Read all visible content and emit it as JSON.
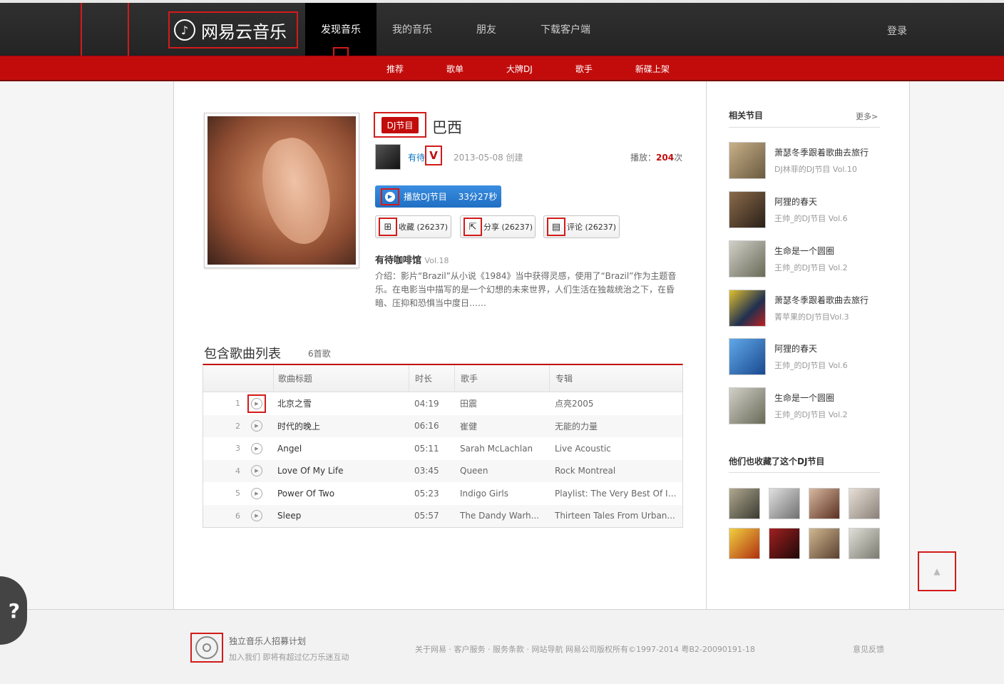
{
  "header": {
    "logo_text": "网易云音乐",
    "nav": [
      "发现音乐",
      "我的音乐",
      "朋友",
      "下载客户端"
    ],
    "login": "登录",
    "subnav": [
      "推荐",
      "歌单",
      "大牌DJ",
      "歌手",
      "新碟上架"
    ]
  },
  "program": {
    "tag": "DJ节目",
    "title": "巴西",
    "author": "有待",
    "verified_badge": "V",
    "created": "2013-05-08 创建",
    "plays_label": "播放：",
    "plays_count": "204",
    "plays_unit": "次",
    "play_button": "播放DJ节目",
    "duration": "33分27秒",
    "actions": {
      "collect": "收藏 (26237)",
      "share": "分享 (26237)",
      "comment": "评论 (26237)"
    },
    "radio_name": "有待咖啡馆",
    "radio_vol": "Vol.18",
    "description": "介绍：影片“Brazil”从小说《1984》当中获得灵感，使用了“Brazil”作为主题音乐。在电影当中描写的是一个幻想的未来世界，人们生活在独裁统治之下，在昏暗、压抑和恐惧当中度日……"
  },
  "songlist": {
    "title": "包含歌曲列表",
    "count": "6首歌",
    "headers": {
      "title": "歌曲标题",
      "duration": "时长",
      "artist": "歌手",
      "album": "专辑"
    },
    "rows": [
      {
        "idx": "1",
        "title": "北京之雪",
        "duration": "04:19",
        "artist": "田震",
        "album": "点亮2005"
      },
      {
        "idx": "2",
        "title": "时代的晚上",
        "duration": "06:16",
        "artist": "崔健",
        "album": "无能的力量"
      },
      {
        "idx": "3",
        "title": "Angel",
        "duration": "05:11",
        "artist": "Sarah McLachlan",
        "album": "Live Acoustic"
      },
      {
        "idx": "4",
        "title": "Love Of My Life",
        "duration": "03:45",
        "artist": "Queen",
        "album": "Rock Montreal"
      },
      {
        "idx": "5",
        "title": "Power Of Two",
        "duration": "05:23",
        "artist": "Indigo Girls",
        "album": "Playlist: The Very Best Of In..."
      },
      {
        "idx": "6",
        "title": "Sleep",
        "duration": "05:57",
        "artist": "The Dandy Warh...",
        "album": "Thirteen Tales From Urban..."
      }
    ]
  },
  "sidebar": {
    "related_title": "相关节目",
    "more": "更多>",
    "related": [
      {
        "name": "萧瑟冬季跟着歌曲去旅行",
        "sub": "DJ林菲的DJ节目 Vol.10",
        "color": "#8a7a5a"
      },
      {
        "name": "阿狸的春天",
        "sub": "王帅_的DJ节目 Vol.6",
        "color": "#5a4a3a"
      },
      {
        "name": "生命是一个圆圈",
        "sub": "王帅_的DJ节目 Vol.2",
        "color": "#7a7a6a"
      },
      {
        "name": "萧瑟冬季跟着歌曲去旅行",
        "sub": "菁苹果的DJ节目Vol.3",
        "color": "#c4a020"
      },
      {
        "name": "阿狸的春天",
        "sub": "王帅_的DJ节目 Vol.6",
        "color": "#2a6ab0"
      },
      {
        "name": "生命是一个圆圈",
        "sub": "王帅_的DJ节目 Vol.2",
        "color": "#8a8a7a"
      }
    ],
    "collectors_title": "他们也收藏了这个DJ节目",
    "collectors": [
      "#6a6a5a",
      "#9a9a9a",
      "#8a5a4a",
      "#b0a8a0",
      "#d0801a",
      "#6a1a1a",
      "#a08060",
      "#7a7a70"
    ]
  },
  "footer": {
    "plan_title": "独立音乐人招募计划",
    "plan_sub": "加入我们 即将有超过亿万乐迷互动",
    "links": "关于网易 · 客户服务 · 服务条款 · 网站导航    网易公司版权所有©1997-2014 粤B2-20090191-18",
    "feedback": "意见反馈"
  }
}
